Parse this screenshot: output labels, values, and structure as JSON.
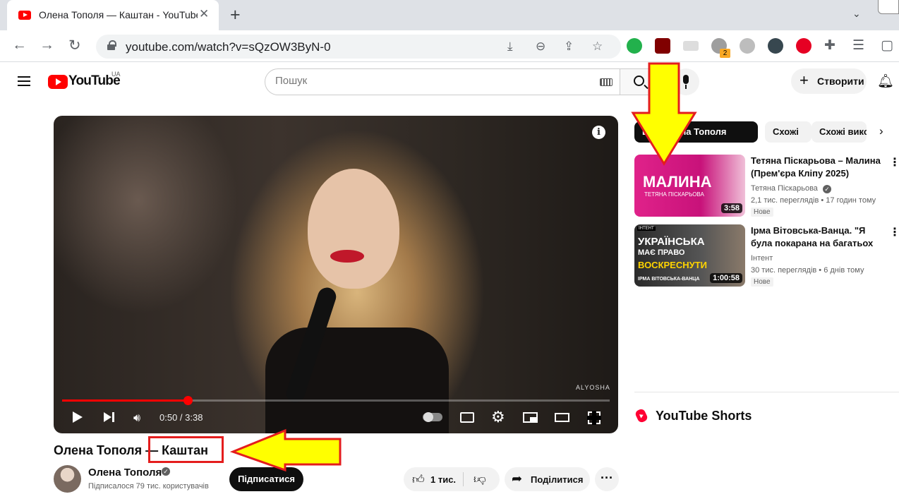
{
  "browser": {
    "tab_title": "Олена Тополя — Каштан - YouTube",
    "tab_close": "✕",
    "new_tab": "+",
    "tab_menu": "⌄",
    "url": "youtube.com/watch?v=sQzOW3ByN-0",
    "extension_badge": "2",
    "icons": [
      "back-icon",
      "forward-icon",
      "reload-icon",
      "lock-icon",
      "download-icon",
      "zoom-icon",
      "share-icon",
      "star-icon",
      "extensions-icon",
      "reading-list-icon",
      "side-panel-icon"
    ]
  },
  "header": {
    "logo": "YouTube",
    "region": "UA",
    "search_placeholder": "Пошук",
    "create_label": "Створити"
  },
  "player": {
    "time": "0:50 / 3:38",
    "progress": 0.229,
    "watermark": "ALYOSHA",
    "info": "i"
  },
  "video": {
    "title": "Олена Тополя — Каштан",
    "channel": "Олена Тополя",
    "subscribers": "Підписалося 79 тис. користувачів",
    "subscribe_label": "Підписатися",
    "likes": "1 тис.",
    "share_label": "Поділитися",
    "more_label": "···"
  },
  "sidebar": {
    "chips": [
      "Від: Олена Тополя",
      "Схожі",
      "Схожі вико"
    ],
    "videos": [
      {
        "title": "Тетяна Піскарьова – Малина (Прем'єра Кліпу 2025)",
        "channel": "Тетяна Піскарьова",
        "views": "2,1 тис. переглядів",
        "age": "17 годин тому",
        "badge": "Нове",
        "duration": "3:58",
        "thumb_big": "МАЛИНА",
        "thumb_small": "ТЕТЯНА ПІСКАРЬОВА"
      },
      {
        "title": "Ірма Вітовська-Ванца. \"Я була покарана на багатьох канала...",
        "channel": "Інтент",
        "views": "30 тис. переглядів",
        "age": "6 днів тому",
        "badge": "Нове",
        "duration": "1:00:58",
        "thumb_l1": "УКРАЇНСЬКА",
        "thumb_l2": "МАЄ ПРАВО",
        "thumb_l3": "ВОСКРЕСНУТИ",
        "thumb_l4": "ІРМА ВІТОВСЬКА-ВАНЦА",
        "thumb_tag": "ІНТЕНТ"
      }
    ],
    "shorts_title": "YouTube Shorts"
  },
  "colors": {
    "annotation_red": "#e41d1d",
    "annotation_yellow": "#ffff00",
    "youtube_red": "#ff0000"
  }
}
